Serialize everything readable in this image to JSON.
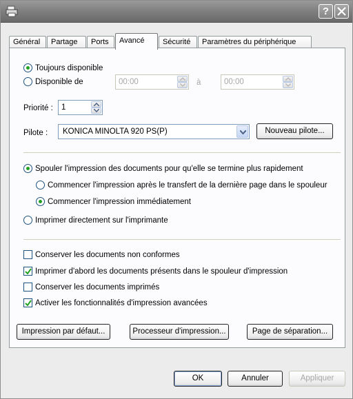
{
  "title_bar": {
    "help_label": "?"
  },
  "tabs": [
    {
      "label": "Général"
    },
    {
      "label": "Partage"
    },
    {
      "label": "Ports"
    },
    {
      "label": "Avancé"
    },
    {
      "label": "Sécurité"
    },
    {
      "label": "Paramètres du périphérique"
    }
  ],
  "availability": {
    "always_label": "Toujours disponible",
    "from_label": "Disponible de",
    "start_time": "00:00",
    "to_label": "à",
    "end_time": "00:00"
  },
  "priority": {
    "label": "Priorité :",
    "value": "1"
  },
  "driver": {
    "label": "Pilote :",
    "selected": "KONICA MINOLTA 920 PS(P)",
    "new_driver_button": "Nouveau pilote..."
  },
  "spool": {
    "spool_option": "Spouler l'impression des documents pour qu'elle se termine plus rapidement",
    "after_last_page": "Commencer l'impression après le transfert de la dernière page dans le spouleur",
    "immediately": "Commencer l'impression immédiatement",
    "direct": "Imprimer directement sur l'imprimante"
  },
  "options": [
    {
      "label": "Conserver les documents non conformes",
      "checked": false
    },
    {
      "label": "Imprimer d'abord les documents présents dans le spouleur d'impression",
      "checked": true
    },
    {
      "label": "Conserver les documents imprimés",
      "checked": false
    },
    {
      "label": "Activer les fonctionnalités d'impression avancées",
      "checked": true
    }
  ],
  "panel_buttons": {
    "defaults": "Impression par défaut...",
    "processor": "Processeur d'impression...",
    "separator": "Page de séparation..."
  },
  "dialog_buttons": {
    "ok": "OK",
    "cancel": "Annuler",
    "apply": "Appliquer"
  }
}
